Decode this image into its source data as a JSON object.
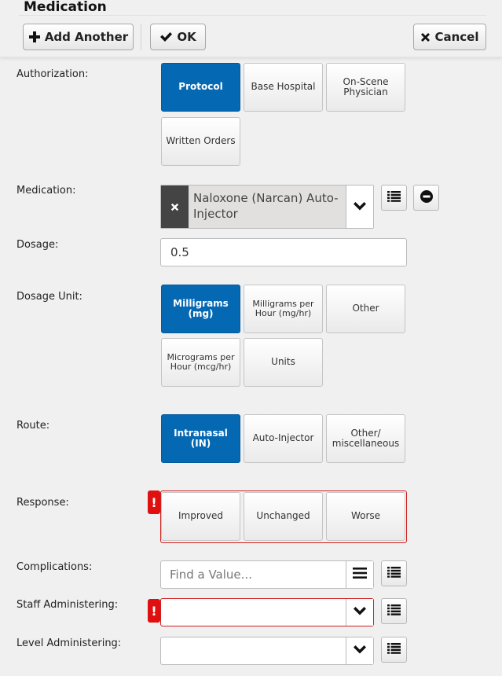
{
  "header": {
    "title": "Medication",
    "add_another": "Add Another",
    "ok": "OK",
    "cancel": "Cancel"
  },
  "authorization": {
    "label": "Authorization:",
    "options": [
      "Protocol",
      "Base Hospital",
      "On-Scene Physician",
      "Written Orders"
    ],
    "selected": "Protocol"
  },
  "medication": {
    "label": "Medication:",
    "value": "Naloxone (Narcan) Auto-Injector"
  },
  "dosage": {
    "label": "Dosage:",
    "value": "0.5"
  },
  "dosage_unit": {
    "label": "Dosage Unit:",
    "options": [
      "Milligrams (mg)",
      "Milligrams per Hour (mg/hr)",
      "Other",
      "Micrograms per Hour (mcg/hr)",
      "Units"
    ],
    "selected": "Milligrams (mg)"
  },
  "route": {
    "label": "Route:",
    "options": [
      "Intranasal (IN)",
      "Auto-Injector",
      "Other/ miscellaneous"
    ],
    "selected": "Intranasal (IN)"
  },
  "response": {
    "label": "Response:",
    "options": [
      "Improved",
      "Unchanged",
      "Worse"
    ],
    "required_alert": "!"
  },
  "complications": {
    "label": "Complications:",
    "placeholder": "Find a Value..."
  },
  "staff_administering": {
    "label": "Staff Administering:",
    "value": "",
    "required_alert": "!"
  },
  "level_administering": {
    "label": "Level Administering:",
    "value": ""
  },
  "colors": {
    "selected": "#0568b3",
    "error": "#e01010",
    "background": "#f0f0f0"
  },
  "icons": [
    "plus-icon",
    "check-icon",
    "close-icon",
    "list-icon",
    "minus-circle-icon",
    "chevron-down-icon",
    "hamburger-icon"
  ]
}
